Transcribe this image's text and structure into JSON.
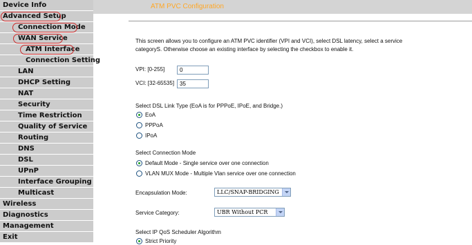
{
  "sidebar": {
    "items": [
      {
        "label": "Device Info"
      },
      {
        "label": "Advanced Setup"
      },
      {
        "label": "Connection Mode"
      },
      {
        "label": "WAN Service"
      },
      {
        "label": "ATM Interface"
      },
      {
        "label": "Connection Setting"
      },
      {
        "label": "LAN"
      },
      {
        "label": "DHCP Setting"
      },
      {
        "label": "NAT"
      },
      {
        "label": "Security"
      },
      {
        "label": "Time Restriction"
      },
      {
        "label": "Quality of Service"
      },
      {
        "label": "Routing"
      },
      {
        "label": "DNS"
      },
      {
        "label": "DSL"
      },
      {
        "label": "UPnP"
      },
      {
        "label": "Interface Grouping"
      },
      {
        "label": "Multicast"
      },
      {
        "label": "Wireless"
      },
      {
        "label": "Diagnostics"
      },
      {
        "label": "Management"
      },
      {
        "label": "Exit"
      }
    ]
  },
  "header": {
    "title": "ATM PVC Configuration"
  },
  "intro": {
    "line1": "This screen allows you to configure an ATM PVC identifier (VPI and VCI), select DSL latency, select a service",
    "line2": "categoryS. Otherwise choose an existing interface by selecting the checkbox to enable it."
  },
  "vpi": {
    "label": "VPI: [0-255]",
    "value": "0"
  },
  "vci": {
    "label": "VCI: [32-65535]",
    "value": "35"
  },
  "link_type": {
    "heading": "Select DSL Link Type (EoA is for PPPoE, IPoE, and Bridge.)",
    "options": [
      "EoA",
      "PPPoA",
      "IPoA"
    ],
    "selected": "EoA"
  },
  "conn_mode": {
    "heading": "Select Connection Mode",
    "options": [
      "Default Mode - Single service over one connection",
      "VLAN MUX Mode - Multiple Vlan service over one connection"
    ],
    "selected": "Default Mode - Single service over one connection"
  },
  "encapsulation": {
    "label": "Encapsulation Mode:",
    "value": "LLC/SNAP-BRIDGING"
  },
  "service_category": {
    "label": "Service Category:",
    "value": "UBR Without PCR"
  },
  "qos": {
    "heading": "Select IP QoS Scheduler Algorithm",
    "option": "Strict Priority",
    "selected": "Strict Priority"
  },
  "colors": {
    "title_orange": "#ffa726",
    "sidebar_bg": "#cccccc",
    "highlight_circle": "#cc2a2a"
  }
}
